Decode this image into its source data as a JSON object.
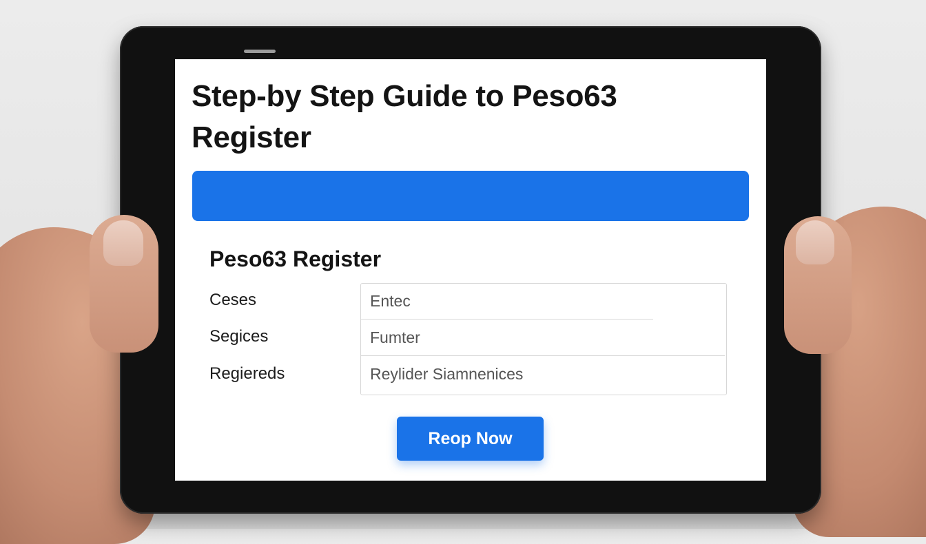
{
  "page": {
    "title": "Step-by Step Guide to Peso63 Register"
  },
  "form": {
    "title": "Peso63 Register",
    "fields": [
      {
        "label": "Ceses",
        "value": "Entec"
      },
      {
        "label": "Segices",
        "value": "Fumter"
      },
      {
        "label": "Regiereds",
        "value": "Reylider Siamnenices"
      }
    ],
    "submit_label": "Reop Now"
  },
  "colors": {
    "accent": "#1a73e8",
    "tablet_bezel": "#111111",
    "screen_background": "#ffffff",
    "title_text": "#141414"
  }
}
